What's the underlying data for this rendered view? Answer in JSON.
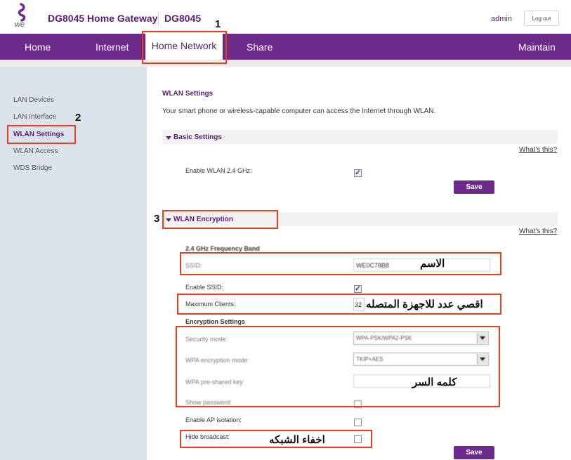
{
  "header": {
    "logo_text": "we",
    "app_title": "DG8045 Home Gateway",
    "model": "DG8045",
    "user": "admin",
    "logout_label": "Log out"
  },
  "nav": {
    "items": [
      "Home",
      "Internet",
      "Home Network",
      "Share",
      "Maintain"
    ],
    "active": "Home Network"
  },
  "sidebar": {
    "items": [
      "LAN Devices",
      "LAN Interface",
      "WLAN Settings",
      "WLAN Access",
      "WDS Bridge"
    ],
    "active": "WLAN Settings"
  },
  "main": {
    "title": "WLAN Settings",
    "description": "Your smart phone or wireless-capable computer can access the Internet through WLAN.",
    "basic": {
      "section_label": "Basic Settings",
      "whats_this": "What's this?",
      "enable_wlan_label": "Enable WLAN 2.4 GHz:",
      "enable_wlan_checked": true,
      "save_label": "Save"
    },
    "encryption": {
      "section_label": "WLAN Encryption",
      "whats_this": "What's this?",
      "band_heading": "2.4 GHz Frequency Band",
      "ssid_label": "SSID:",
      "ssid_value": "WE0C78B8",
      "enable_ssid_label": "Enable SSID:",
      "enable_ssid_checked": true,
      "max_clients_label": "Maximum Clients:",
      "max_clients_value": "32",
      "enc_heading": "Encryption Settings",
      "security_mode_label": "Security mode:",
      "security_mode_value": "WPA-PSK/WPA2-PSK",
      "wpa_mode_label": "WPA encryption mode:",
      "wpa_mode_value": "TKIP+AES",
      "psk_label": "WPA pre-shared key:",
      "show_password_label": "Show password:",
      "ap_isolation_label": "Enable AP isolation:",
      "hide_broadcast_label": "Hide broadcast:",
      "save_label": "Save"
    }
  },
  "annotations": {
    "step1": "1",
    "step2": "2",
    "step3": "3",
    "ssid_note": "الاسم",
    "max_clients_note": "اقصي عدد للاجهزة المتصله",
    "password_note": "كلمه السر",
    "hide_note": "اخفاء الشبكه"
  },
  "colors": {
    "brand_purple": "#6c2a8a",
    "annotation_red": "#e8401c"
  }
}
